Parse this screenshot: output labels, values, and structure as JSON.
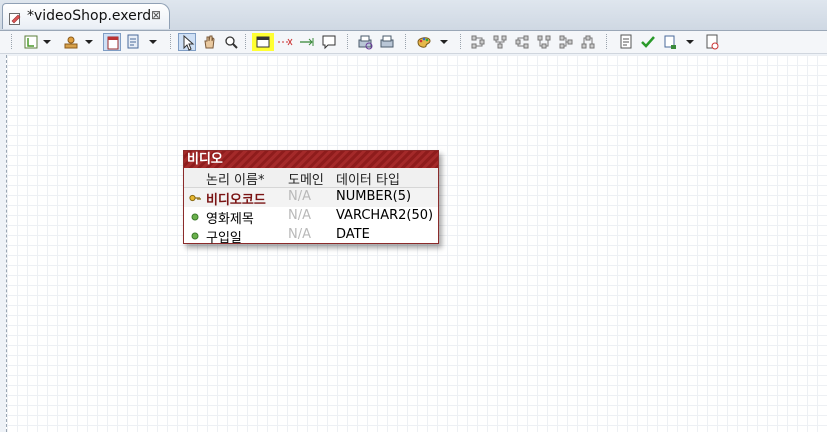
{
  "tab": {
    "title": "*videoShop.exerd",
    "close_glyph": "⊠"
  },
  "toolbar": {
    "icons": [
      "layout-icon",
      "chevron-down-icon",
      "stamp-icon",
      "chevron-down-icon",
      "notation-icon",
      "page-icon",
      "chevron-down-icon",
      "select-arrow-icon",
      "hand-icon",
      "zoom-icon",
      "entity-icon",
      "relationship-icon",
      "identifying-relationship-icon",
      "note-icon",
      "print-preview-icon",
      "print-icon",
      "palette-icon",
      "chevron-down-icon",
      "align-left-icon",
      "align-center-icon",
      "align-right-icon",
      "align-top-icon",
      "align-middle-icon",
      "align-bottom-icon",
      "report-icon",
      "validate-icon",
      "generate-icon",
      "chevron-down-icon",
      "settings-icon"
    ],
    "highlight_color": "#ffff33"
  },
  "entity": {
    "title": "비디오",
    "columns": {
      "logical_name": "논리 이름*",
      "domain": "도메인",
      "data_type": "데이터 타입"
    },
    "rows": [
      {
        "name": "비디오코드",
        "domain": "N/A",
        "type": "NUMBER(5)",
        "key": "primary-key"
      },
      {
        "name": "영화제목",
        "domain": "N/A",
        "type": "VARCHAR2(50)",
        "key": "attribute"
      },
      {
        "name": "구입일",
        "domain": "N/A",
        "type": "DATE",
        "key": "attribute"
      }
    ],
    "header_color": "#a42a2a"
  }
}
